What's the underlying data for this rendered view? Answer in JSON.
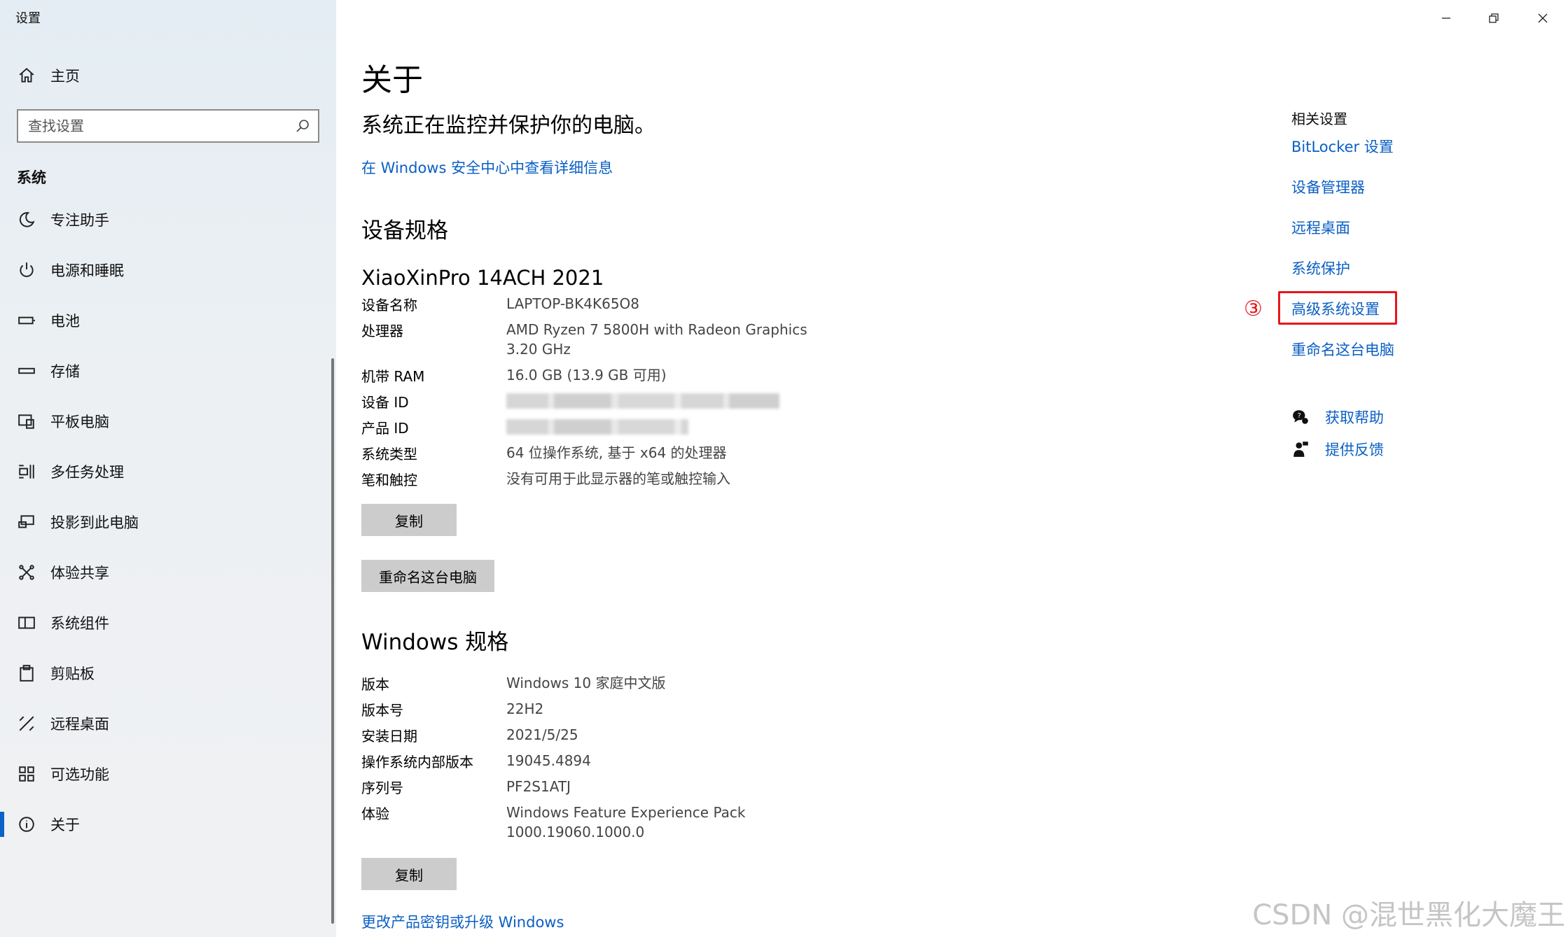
{
  "window": {
    "title": "设置",
    "controls": {
      "minimize": "minimize-icon",
      "restore": "restore-icon",
      "close": "close-icon"
    }
  },
  "sidebar": {
    "home": {
      "label": "主页",
      "icon": "home-icon"
    },
    "search": {
      "placeholder": "查找设置",
      "icon": "search-icon"
    },
    "section_title": "系统",
    "items": [
      {
        "label": "专注助手",
        "icon": "moon-icon"
      },
      {
        "label": "电源和睡眠",
        "icon": "power-icon"
      },
      {
        "label": "电池",
        "icon": "battery-icon"
      },
      {
        "label": "存储",
        "icon": "storage-icon"
      },
      {
        "label": "平板电脑",
        "icon": "tablet-icon"
      },
      {
        "label": "多任务处理",
        "icon": "multitask-icon"
      },
      {
        "label": "投影到此电脑",
        "icon": "project-icon"
      },
      {
        "label": "体验共享",
        "icon": "share-icon"
      },
      {
        "label": "系统组件",
        "icon": "components-icon"
      },
      {
        "label": "剪贴板",
        "icon": "clipboard-icon"
      },
      {
        "label": "远程桌面",
        "icon": "remote-icon"
      },
      {
        "label": "可选功能",
        "icon": "features-icon"
      },
      {
        "label": "关于",
        "icon": "info-icon",
        "active": true
      }
    ]
  },
  "main": {
    "title": "关于",
    "status": "系统正在监控并保护你的电脑。",
    "security_link": "在 Windows 安全中心中查看详细信息",
    "device_spec": {
      "heading": "设备规格",
      "model": "XiaoXinPro 14ACH 2021",
      "rows": [
        {
          "key": "设备名称",
          "value": "LAPTOP-BK4K65O8"
        },
        {
          "key": "处理器",
          "value": "AMD Ryzen 7 5800H with Radeon Graphics",
          "value2": "3.20 GHz"
        },
        {
          "key": "机带 RAM",
          "value": "16.0 GB (13.9 GB 可用)"
        },
        {
          "key": "设备 ID",
          "value": ""
        },
        {
          "key": "产品 ID",
          "value": ""
        },
        {
          "key": "系统类型",
          "value": "64 位操作系统, 基于 x64 的处理器"
        },
        {
          "key": "笔和触控",
          "value": "没有可用于此显示器的笔或触控输入"
        }
      ],
      "copy_label": "复制",
      "rename_label": "重命名这台电脑"
    },
    "windows_spec": {
      "heading": "Windows 规格",
      "rows": [
        {
          "key": "版本",
          "value": "Windows 10 家庭中文版"
        },
        {
          "key": "版本号",
          "value": "22H2"
        },
        {
          "key": "安装日期",
          "value": "2021/5/25"
        },
        {
          "key": "操作系统内部版本",
          "value": "19045.4894"
        },
        {
          "key": "序列号",
          "value": "PF2S1ATJ"
        },
        {
          "key": "体验",
          "value": "Windows Feature Experience Pack",
          "value2": "1000.19060.1000.0"
        }
      ],
      "copy_label": "复制",
      "upgrade_link": "更改产品密钥或升级 Windows"
    }
  },
  "related": {
    "heading": "相关设置",
    "links": [
      "BitLocker 设置",
      "设备管理器",
      "远程桌面",
      "系统保护",
      "高级系统设置",
      "重命名这台电脑"
    ],
    "step_marker": "③",
    "highlight_color": "#e8161c",
    "help": [
      {
        "label": "获取帮助",
        "icon": "help-chat-icon"
      },
      {
        "label": "提供反馈",
        "icon": "feedback-icon"
      }
    ]
  },
  "watermark": "CSDN @混世黑化大魔王",
  "colors": {
    "accent": "#0a5fc4",
    "button_bg": "#cccccc",
    "active_bar": "#0a64c8"
  }
}
